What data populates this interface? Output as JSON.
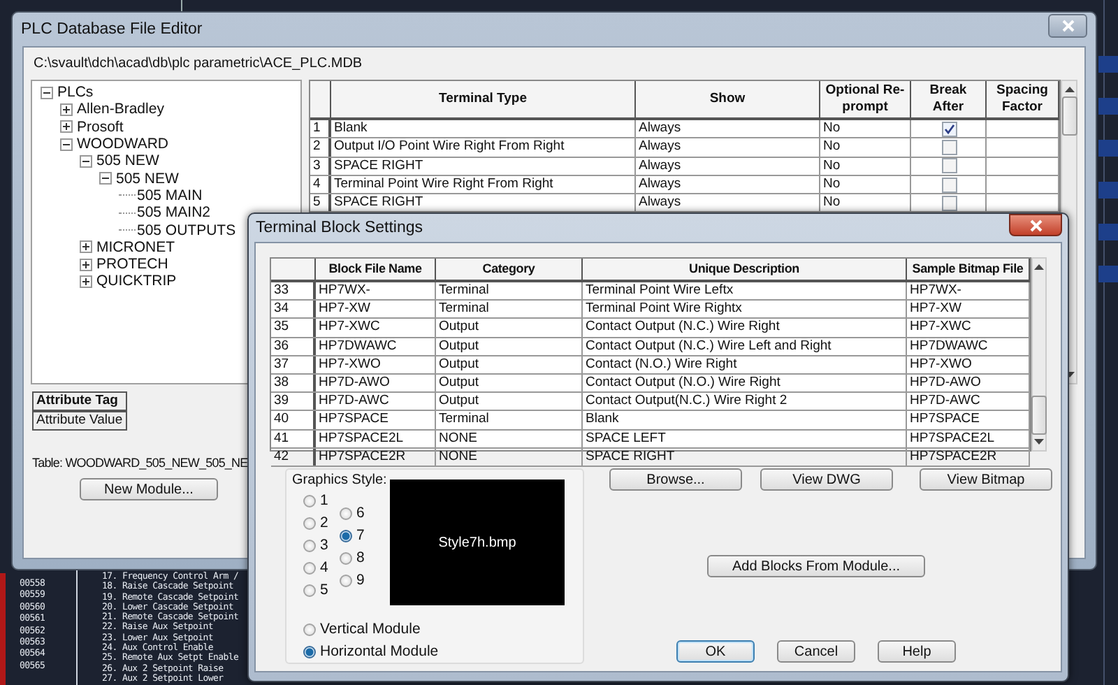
{
  "cad_background": {
    "line_numbers": [
      "00558",
      "00559",
      "00560",
      "00561",
      "00562",
      "00563",
      "00564",
      "00565"
    ],
    "items": [
      "17. Frequency Control Arm /",
      "18. Raise Cascade Setpoint",
      "19. Remote Cascade Setpoint",
      "20. Lower Cascade Setpoint",
      "21. Remote Cascade Setpoint",
      "22. Raise Aux Setpoint",
      "23. Lower Aux Setpoint",
      "24. Aux Control Enable",
      "25. Remote Aux Setpt Enable",
      "26. Aux 2 Setpoint Raise",
      "27. Aux 2 Setpoint Lower"
    ]
  },
  "main_window": {
    "title": "PLC Database File Editor",
    "path": "C:\\svault\\dch\\acad\\db\\plc parametric\\ACE_PLC.MDB",
    "tree": [
      {
        "label": "PLCs",
        "kind": "folder",
        "expanded": true,
        "children": [
          {
            "label": "Allen-Bradley",
            "kind": "folder",
            "expanded": false
          },
          {
            "label": "Prosoft",
            "kind": "folder",
            "expanded": false
          },
          {
            "label": "WOODWARD",
            "kind": "folder",
            "expanded": true,
            "children": [
              {
                "label": "505 NEW",
                "kind": "folder",
                "expanded": true,
                "children": [
                  {
                    "label": "505 NEW",
                    "kind": "folder",
                    "expanded": true,
                    "children": [
                      {
                        "label": "505 MAIN",
                        "kind": "leaf"
                      },
                      {
                        "label": "505 MAIN2",
                        "kind": "leaf"
                      },
                      {
                        "label": "505 OUTPUTS",
                        "kind": "leaf"
                      }
                    ]
                  }
                ]
              },
              {
                "label": "MICRONET",
                "kind": "folder",
                "expanded": false
              },
              {
                "label": "PROTECH",
                "kind": "folder",
                "expanded": false
              },
              {
                "label": "QUICKTRIP",
                "kind": "folder",
                "expanded": false
              }
            ]
          }
        ]
      }
    ],
    "table": {
      "columns": [
        "Terminal Type",
        "Show",
        "Optional Re-prompt",
        "Break After",
        "Spacing Factor"
      ],
      "rows": [
        {
          "index": "1",
          "terminal_type": "Blank",
          "show": "Always",
          "optional_reprompt": "No",
          "break_after": true
        },
        {
          "index": "2",
          "terminal_type": "Output I/O Point Wire Right From Right",
          "show": "Always",
          "optional_reprompt": "No",
          "break_after": false
        },
        {
          "index": "3",
          "terminal_type": "SPACE RIGHT",
          "show": "Always",
          "optional_reprompt": "No",
          "break_after": false
        },
        {
          "index": "4",
          "terminal_type": "Terminal Point Wire Right From Right",
          "show": "Always",
          "optional_reprompt": "No",
          "break_after": false
        },
        {
          "index": "5",
          "terminal_type": "SPACE RIGHT",
          "show": "Always",
          "optional_reprompt": "No",
          "break_after": false
        }
      ]
    },
    "attribute_headers": [
      "Attribute Tag",
      "Attribute Value"
    ],
    "table_label": "Table: WOODWARD_505_NEW_505_NE",
    "buttons": [
      "New Module..."
    ]
  },
  "dialog": {
    "title": "Terminal Block Settings",
    "table": {
      "columns": [
        "Block File Name",
        "Category",
        "Unique Description",
        "Sample Bitmap File"
      ],
      "rows": [
        {
          "index": "33",
          "block": "HP7WX-",
          "category": "Terminal",
          "description": "Terminal Point Wire Leftx",
          "bitmap": "HP7WX-"
        },
        {
          "index": "34",
          "block": "HP7-XW",
          "category": "Terminal",
          "description": "Terminal Point Wire Rightx",
          "bitmap": "HP7-XW"
        },
        {
          "index": "35",
          "block": "HP7-XWC",
          "category": "Output",
          "description": "Contact Output (N.C.) Wire Right",
          "bitmap": "HP7-XWC"
        },
        {
          "index": "36",
          "block": "HP7DWAWC",
          "category": "Output",
          "description": "Contact Output (N.C.) Wire Left and Right",
          "bitmap": "HP7DWAWC"
        },
        {
          "index": "37",
          "block": "HP7-XWO",
          "category": "Output",
          "description": "Contact (N.O.) Wire Right",
          "bitmap": "HP7-XWO"
        },
        {
          "index": "38",
          "block": "HP7D-AWO",
          "category": "Output",
          "description": "Contact Output (N.O.) Wire Right",
          "bitmap": "HP7D-AWO"
        },
        {
          "index": "39",
          "block": "HP7D-AWC",
          "category": "Output",
          "description": "Contact Output(N.C.) Wire Right 2",
          "bitmap": "HP7D-AWC"
        },
        {
          "index": "40",
          "block": "HP7SPACE",
          "category": "Terminal",
          "description": "Blank",
          "bitmap": "HP7SPACE"
        },
        {
          "index": "41",
          "block": "HP7SPACE2L",
          "category": "NONE",
          "description": "SPACE LEFT",
          "bitmap": "HP7SPACE2L"
        },
        {
          "index": "42",
          "block": "HP7SPACE2R",
          "category": "NONE",
          "description": "SPACE RIGHT",
          "bitmap": "HP7SPACE2R"
        }
      ]
    },
    "graphics_style": {
      "label": "Graphics Style:",
      "preview": "Style7h.bmp",
      "styles": [
        {
          "label": "1",
          "selected": false
        },
        {
          "label": "2",
          "selected": false
        },
        {
          "label": "3",
          "selected": false
        },
        {
          "label": "4",
          "selected": false
        },
        {
          "label": "5",
          "selected": false
        },
        {
          "label": "6",
          "selected": false
        },
        {
          "label": "7",
          "selected": true
        },
        {
          "label": "8",
          "selected": false
        },
        {
          "label": "9",
          "selected": false
        }
      ],
      "orientation": [
        {
          "label": "Vertical Module",
          "selected": false
        },
        {
          "label": "Horizontal Module",
          "selected": true
        }
      ]
    },
    "buttons": [
      "Browse...",
      "View DWG",
      "View Bitmap"
    ],
    "add_button": "Add Blocks From Module...",
    "footer_buttons": [
      {
        "label": "OK",
        "default": true
      },
      {
        "label": "Cancel",
        "default": false
      },
      {
        "label": "Help",
        "default": false
      }
    ]
  }
}
